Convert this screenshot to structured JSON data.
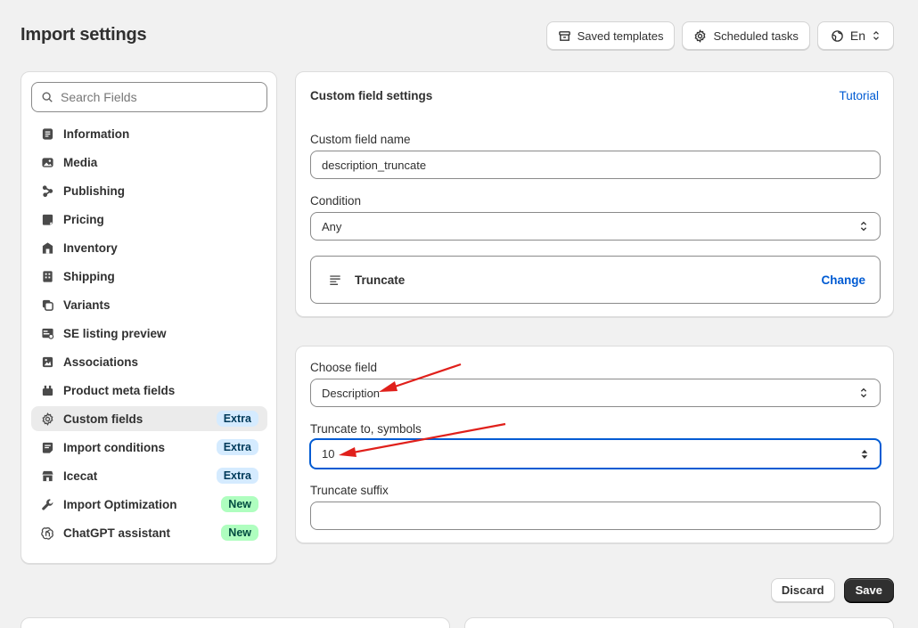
{
  "page": {
    "title": "Import settings"
  },
  "header": {
    "saved_templates": "Saved templates",
    "scheduled_tasks": "Scheduled tasks",
    "language": "En"
  },
  "sidebar": {
    "search_placeholder": "Search Fields",
    "items": [
      {
        "label": "Information",
        "icon": "information-icon"
      },
      {
        "label": "Media",
        "icon": "media-icon"
      },
      {
        "label": "Publishing",
        "icon": "publishing-icon"
      },
      {
        "label": "Pricing",
        "icon": "pricing-icon"
      },
      {
        "label": "Inventory",
        "icon": "inventory-icon"
      },
      {
        "label": "Shipping",
        "icon": "shipping-icon"
      },
      {
        "label": "Variants",
        "icon": "variants-icon"
      },
      {
        "label": "SE listing preview",
        "icon": "se-listing-icon"
      },
      {
        "label": "Associations",
        "icon": "associations-icon"
      },
      {
        "label": "Product meta fields",
        "icon": "meta-fields-icon"
      },
      {
        "label": "Custom fields",
        "icon": "gear-icon",
        "badge": "Extra",
        "active": true
      },
      {
        "label": "Import conditions",
        "icon": "import-conditions-icon",
        "badge": "Extra"
      },
      {
        "label": "Icecat",
        "icon": "icecat-icon",
        "badge": "Extra"
      },
      {
        "label": "Import Optimization",
        "icon": "wrench-icon",
        "badge": "New"
      },
      {
        "label": "ChatGPT assistant",
        "icon": "chatgpt-icon",
        "badge": "New"
      }
    ]
  },
  "custom_field_settings": {
    "title": "Custom field settings",
    "tutorial": "Tutorial",
    "name_label": "Custom field name",
    "name_value": "description_truncate",
    "condition_label": "Condition",
    "condition_value": "Any",
    "action_name": "Truncate",
    "action_change": "Change"
  },
  "truncate_settings": {
    "choose_field_label": "Choose field",
    "choose_field_value": "Description",
    "truncate_to_label": "Truncate to, symbols",
    "truncate_to_value": "10",
    "suffix_label": "Truncate suffix",
    "suffix_value": ""
  },
  "footer": {
    "discard": "Discard",
    "save": "Save"
  },
  "colors": {
    "accent": "#005bd3",
    "annotation_arrow": "#e0201b",
    "save_bg": "#303030"
  }
}
